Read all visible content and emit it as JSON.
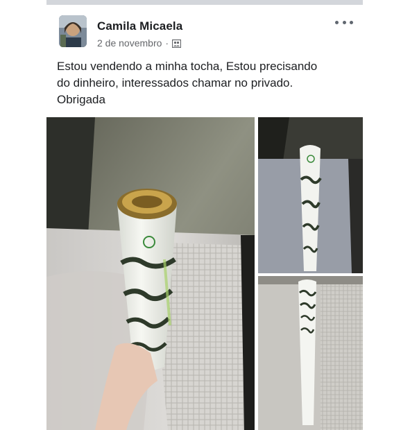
{
  "post": {
    "author": "Camila Micaela",
    "date": "2 de novembro",
    "separator": "·",
    "privacy_icon": "friends-icon",
    "more_icon": "ellipsis-icon",
    "text_lines": [
      "Estou vendendo a minha tocha, Estou precisando",
      "do dinheiro, interessados chamar no privado.",
      "Obrigada"
    ]
  },
  "photos": [
    {
      "subject": "olympic-torch-held-in-hand"
    },
    {
      "subject": "olympic-torch-on-bed"
    },
    {
      "subject": "olympic-torch-full-length"
    }
  ],
  "colors": {
    "author_text": "#1c1e21",
    "meta_text": "#65676b",
    "top_bar": "#d3d6db"
  }
}
